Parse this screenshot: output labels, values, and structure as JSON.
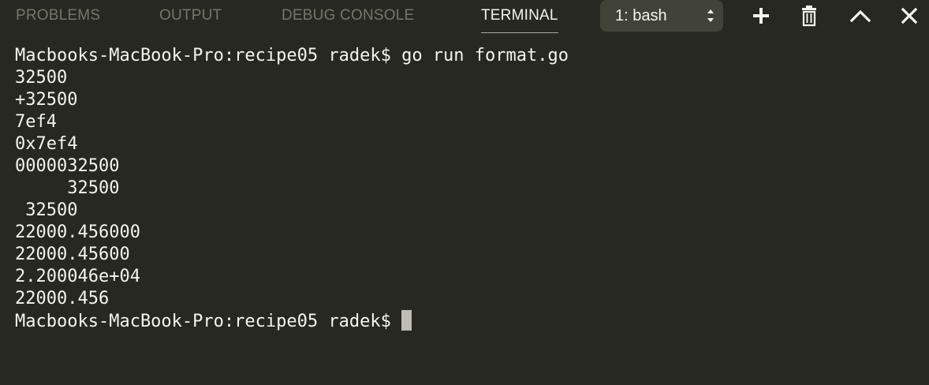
{
  "tabs": {
    "problems": "PROBLEMS",
    "output": "OUTPUT",
    "debug_console": "DEBUG CONSOLE",
    "terminal": "TERMINAL"
  },
  "active_tab": "terminal",
  "terminal_select": {
    "value": "1: bash"
  },
  "actions": [
    {
      "name": "new-terminal",
      "icon": "plus-icon"
    },
    {
      "name": "kill-terminal",
      "icon": "trash-icon"
    },
    {
      "name": "maximize-panel",
      "icon": "chevron-up-icon"
    },
    {
      "name": "close-panel",
      "icon": "close-icon"
    }
  ],
  "terminal": {
    "command_line": "Macbooks-MacBook-Pro:recipe05 radek$ go run format.go",
    "output": [
      "32500",
      "+32500",
      "7ef4",
      "0x7ef4",
      "0000032500",
      "     32500",
      " 32500",
      "22000.456000",
      "22000.45600",
      "2.200046e+04",
      "22000.456"
    ],
    "prompt": "Macbooks-MacBook-Pro:recipe05 radek$ "
  },
  "colors": {
    "background": "#272822",
    "select_background": "#414339",
    "active_tab": "#f4f4ef",
    "inactive_tab": "#75756b",
    "text": "#f4f4ef",
    "cursor": "#bdbdb6"
  }
}
